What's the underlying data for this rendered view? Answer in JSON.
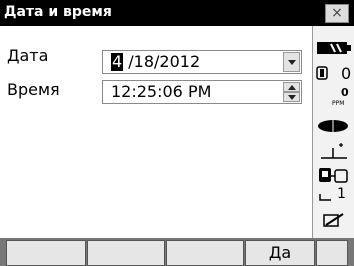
{
  "window": {
    "title": "Дата и время",
    "close_label": "×"
  },
  "form": {
    "date_label": "Дата",
    "date_caret": "4",
    "date_rest": " /18/2012",
    "time_label": "Время",
    "time_value": "12:25:06 PM"
  },
  "sidebar": {
    "offset_value": "0",
    "ppm_value": "0",
    "ppm_unit": "PPM",
    "mode_value": "1"
  },
  "softkeys": [
    {
      "label": ""
    },
    {
      "label": ""
    },
    {
      "label": ""
    },
    {
      "label": "Да"
    }
  ]
}
